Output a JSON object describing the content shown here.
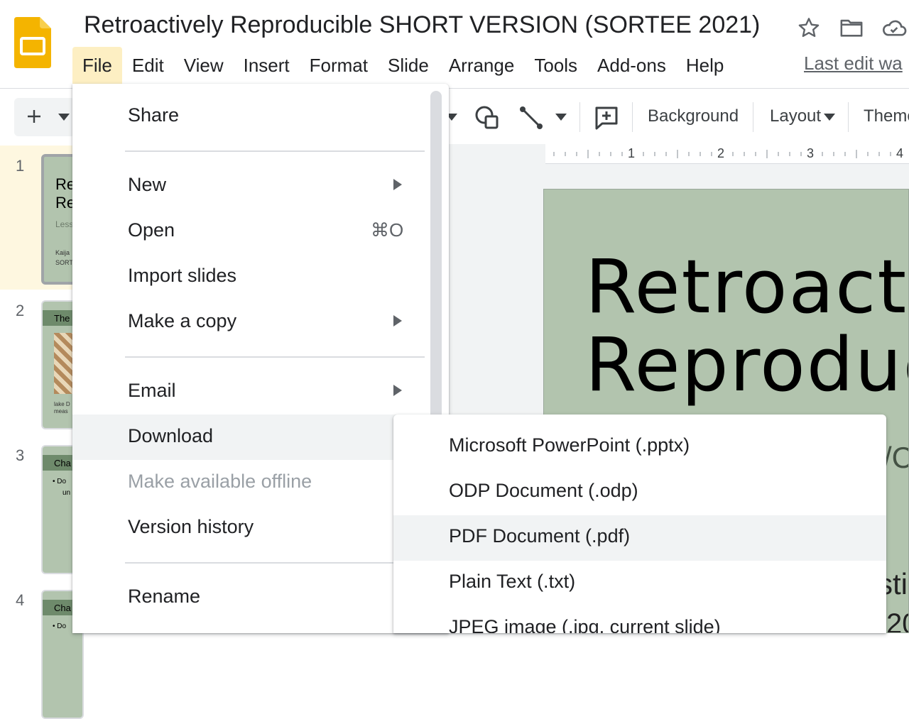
{
  "header": {
    "doc_title": "Retroactively Reproducible SHORT VERSION (SORTEE 2021)",
    "last_edit": "Last edit wa",
    "icons": [
      "slides-logo-icon",
      "star-icon",
      "folder-icon",
      "cloud-icon"
    ]
  },
  "menubar": {
    "items": [
      "File",
      "Edit",
      "View",
      "Insert",
      "Format",
      "Slide",
      "Arrange",
      "Tools",
      "Add-ons",
      "Help"
    ]
  },
  "toolbar": {
    "background": "Background",
    "layout": "Layout",
    "theme": "Theme"
  },
  "ruler": {
    "marks": [
      "1",
      "2",
      "3",
      "4"
    ]
  },
  "filmstrip": {
    "slides": [
      {
        "num": "1",
        "t1": "Re",
        "t2": "Re",
        "t3": "Less",
        "t4": "Kaija",
        "t5": "SORT"
      },
      {
        "num": "2",
        "t1": "The",
        "t2": "",
        "t3": "",
        "t4": "lake D",
        "t5": "meas"
      },
      {
        "num": "3",
        "t1": "Cha",
        "t2": "• Do",
        "t3": "un",
        "t4": "",
        "t5": ""
      },
      {
        "num": "4",
        "t1": "Cha",
        "t2": "• Do",
        "t3": "",
        "t4": "",
        "t5": ""
      }
    ]
  },
  "slide": {
    "title": "Retroactiv\nReproduc",
    "frag1": "/C",
    "frag2": "sti",
    "frag3": "20"
  },
  "file_menu": {
    "share": "Share",
    "new": "New",
    "open": "Open",
    "open_shortcut": "⌘O",
    "import_slides": "Import slides",
    "make_copy": "Make a copy",
    "email": "Email",
    "download": "Download",
    "offline": "Make available offline",
    "version_history": "Version history",
    "rename": "Rename"
  },
  "download_menu": {
    "items": [
      "Microsoft PowerPoint (.pptx)",
      "ODP Document (.odp)",
      "PDF Document (.pdf)",
      "Plain Text (.txt)",
      "JPEG image (.jpg, current slide)"
    ]
  },
  "colors": {
    "slide_bg": "#b2c4ae",
    "menu_active": "#fdefc3",
    "logo": "#f4b400",
    "highlight": "#f1f3f4"
  }
}
